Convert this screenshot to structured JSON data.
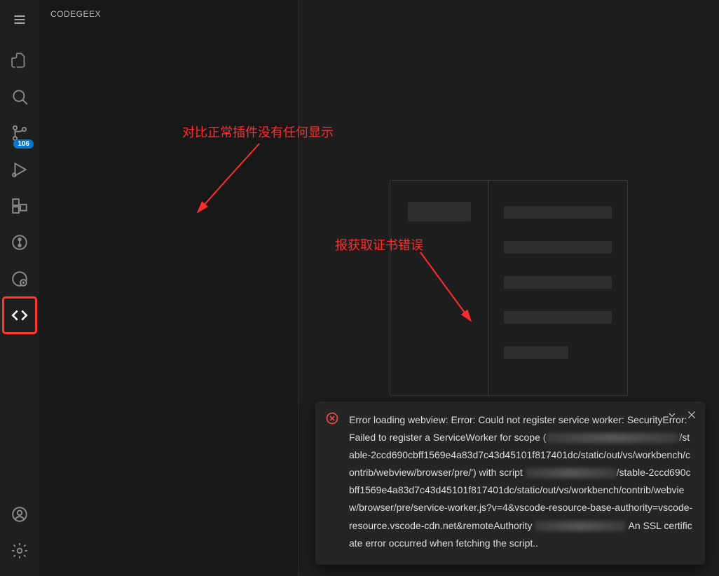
{
  "sidebar": {
    "title": "CODEGEEX",
    "activity_items": [
      {
        "name": "menu-icon"
      },
      {
        "name": "files-icon"
      },
      {
        "name": "search-icon"
      },
      {
        "name": "source-control-icon",
        "badge": "106"
      },
      {
        "name": "run-debug-icon"
      },
      {
        "name": "extensions-icon"
      },
      {
        "name": "git-graph-icon"
      },
      {
        "name": "remote-explorer-icon"
      },
      {
        "name": "codegeex-icon",
        "selected": true
      }
    ],
    "bottom_items": [
      {
        "name": "accounts-icon"
      },
      {
        "name": "settings-gear-icon"
      }
    ]
  },
  "annotations": {
    "a1": "对比正常插件没有任何显示",
    "a2": "报获取证书错误"
  },
  "toast": {
    "head": "Error loading webview: Error: Could not register service worker: SecurityError: Failed to register a ServiceWorker for scope (",
    "path1": "/stable-2ccd690cbff1569e4a83d7c43d45101f817401dc/static/out/vs/workbench/contrib/webview/browser/pre/') with script ",
    "path2": "/stable-2ccd690cbff1569e4a83d7c43d45101f817401dc/static/out/vs/workbench/contrib/webview/browser/pre/service-worker.js?v=4&vscode-resource-base-authority=vscode-resource.vscode-cdn.net&remoteAuthority ",
    "tail": " An SSL certificate error occurred when fetching the script.."
  }
}
